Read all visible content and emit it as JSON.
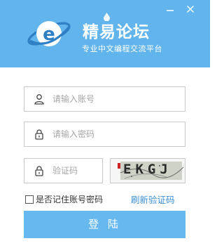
{
  "header": {
    "brand_title": "精易论坛",
    "brand_subtitle": "专业中文编程交流平台",
    "bg_color": "#62b4ec"
  },
  "window": {
    "minimize_icon": "minimize-icon",
    "close_icon": "close-icon"
  },
  "form": {
    "username_placeholder": "请输入账号",
    "password_placeholder": "请输入密码",
    "captcha_placeholder": "验证码",
    "captcha_text": "EKGJ",
    "remember_label": "是否记住账号密码",
    "refresh_label": "刷新验证码",
    "login_label": "登 陆"
  },
  "colors": {
    "accent": "#62b4ec",
    "link": "#3c8fd6",
    "button": "#66b8ee"
  }
}
